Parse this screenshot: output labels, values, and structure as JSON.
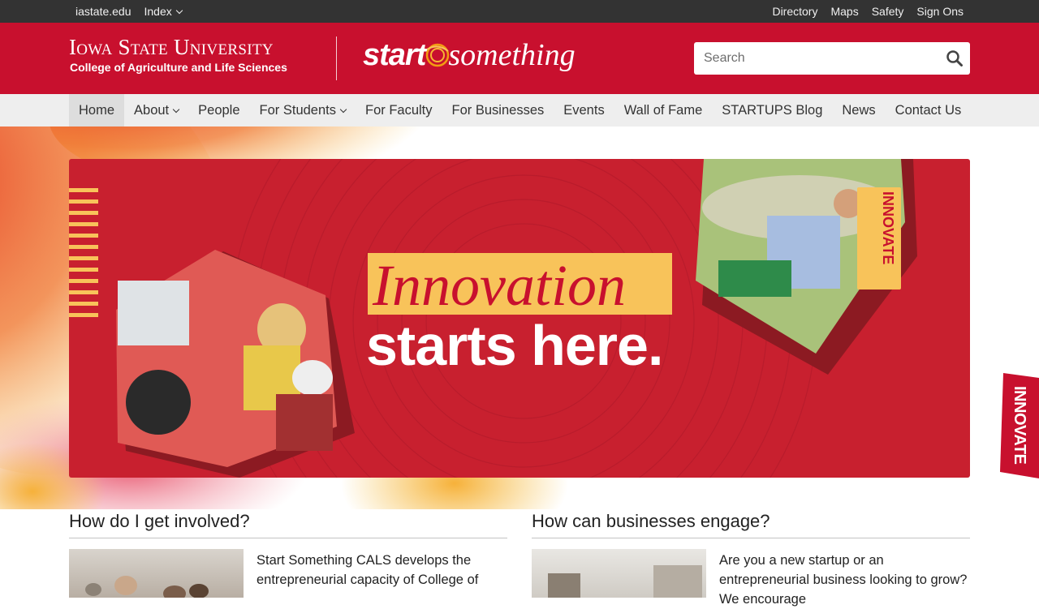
{
  "topbar": {
    "left": [
      "iastate.edu",
      "Index"
    ],
    "right": [
      "Directory",
      "Maps",
      "Safety",
      "Sign Ons"
    ]
  },
  "header": {
    "university": "Iowa State University",
    "college": "College of Agriculture and Life Sciences",
    "brand_part1": "start",
    "brand_part2": "something",
    "search_placeholder": "Search"
  },
  "nav": {
    "items": [
      "Home",
      "About",
      "People",
      "For Students",
      "For Faculty",
      "For Businesses",
      "Events",
      "Wall of Fame",
      "STARTUPS Blog",
      "News",
      "Contact Us"
    ]
  },
  "hero": {
    "headline_1": "Innovation",
    "headline_2": "starts here.",
    "badge": "INNOVATE",
    "side_tab": "INNOVATE"
  },
  "sections": [
    {
      "title": "How do I get involved?",
      "text": "Start Something CALS develops the entrepreneurial capacity of College of"
    },
    {
      "title": "How can businesses engage?",
      "text": "Are you a new startup or an entrepreneurial business looking to grow? We encourage"
    }
  ],
  "colors": {
    "brand_red": "#c8102e",
    "gold": "#f8c35a",
    "topbar": "#333333"
  }
}
